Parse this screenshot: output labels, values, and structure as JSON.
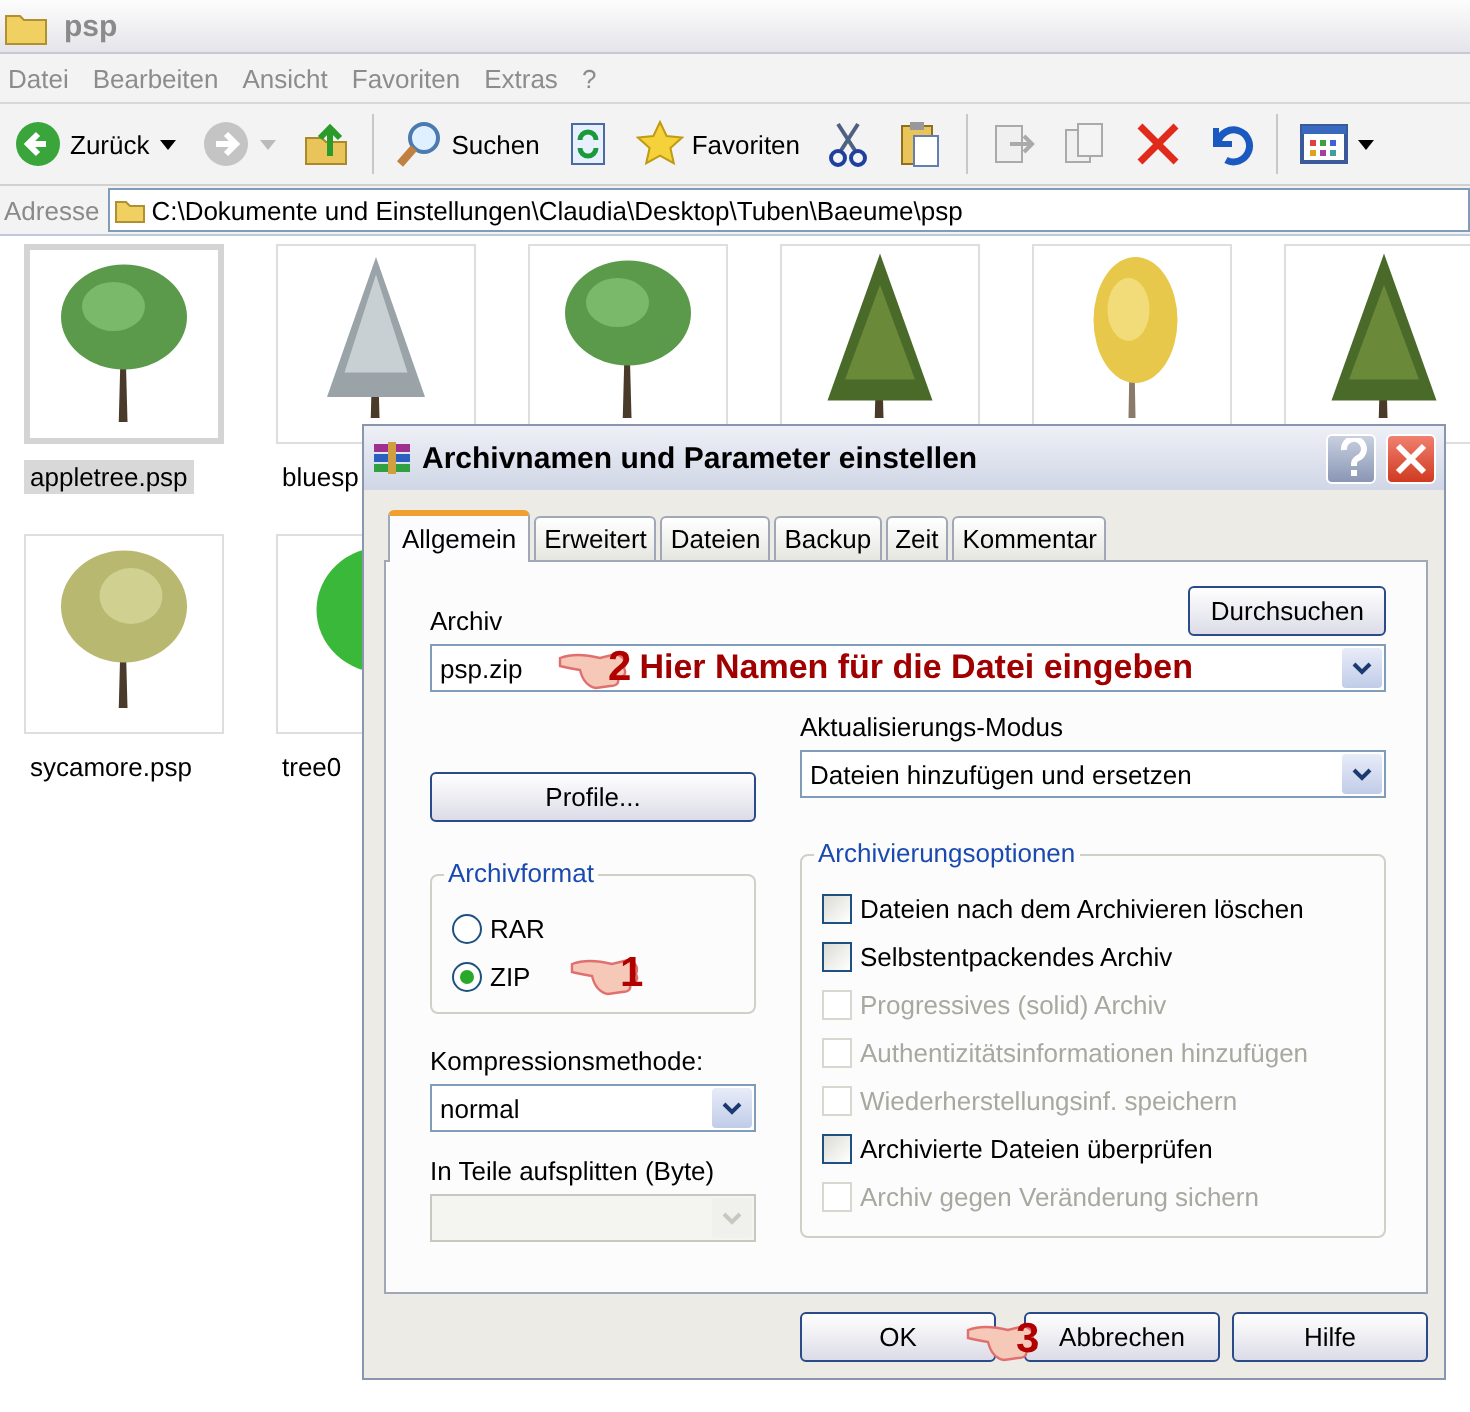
{
  "window": {
    "title": "psp"
  },
  "menu": [
    "Datei",
    "Bearbeiten",
    "Ansicht",
    "Favoriten",
    "Extras",
    "?"
  ],
  "toolbar": [
    {
      "kind": "back",
      "label": "Zurück"
    },
    {
      "kind": "forward"
    },
    {
      "kind": "up"
    },
    {
      "kind": "search",
      "label": "Suchen"
    },
    {
      "kind": "sync"
    },
    {
      "kind": "favorites",
      "label": "Favoriten"
    },
    {
      "kind": "cut"
    },
    {
      "kind": "paste"
    },
    {
      "kind": "moveto"
    },
    {
      "kind": "copyto"
    },
    {
      "kind": "delete"
    },
    {
      "kind": "undo"
    },
    {
      "kind": "views"
    }
  ],
  "address": {
    "label": "Adresse",
    "value": "C:\\Dokumente und Einstellungen\\Claudia\\Desktop\\Tuben\\Baeume\\psp"
  },
  "files": [
    {
      "kind": "round",
      "name": "appletree.psp",
      "selected": true
    },
    {
      "kind": "spruce",
      "name": "bluesp",
      "selected": false
    },
    {
      "kind": "round",
      "selected": false
    },
    {
      "kind": "conifer",
      "selected": false
    },
    {
      "kind": "birch",
      "selected": false
    },
    {
      "kind": "conifer",
      "selected": false
    },
    {
      "kind": "sycamore",
      "name": "sycamore.psp",
      "selected": false
    },
    {
      "kind": "bright",
      "name": "tree0",
      "selected": false
    }
  ],
  "dialog": {
    "title": "Archivnamen und Parameter einstellen",
    "tabs": [
      {
        "label": "Allgemein",
        "selected": true
      },
      {
        "label": "Erweitert",
        "selected": false
      },
      {
        "label": "Dateien",
        "selected": false
      },
      {
        "label": "Backup",
        "selected": false
      },
      {
        "label": "Zeit",
        "selected": false
      },
      {
        "label": "Kommentar",
        "selected": false
      }
    ],
    "archive": {
      "label": "Archiv",
      "value": "psp.zip",
      "browse": "Durchsuchen",
      "pointer": {
        "number": "2",
        "text": "Hier Namen für die Datei eingeben"
      }
    },
    "profiles_button": "Profile...",
    "update_mode": {
      "label": "Aktualisierungs-Modus",
      "value": "Dateien hinzufügen und ersetzen"
    },
    "format": {
      "title": "Archivformat",
      "options": [
        {
          "label": "RAR",
          "selected": false
        },
        {
          "label": "ZIP",
          "selected": true
        }
      ],
      "pointer": {
        "number": "1"
      }
    },
    "compression": {
      "label": "Kompressionsmethode:",
      "value": "normal"
    },
    "split": {
      "label": "In Teile aufsplitten (Byte)",
      "disabled": true
    },
    "options": {
      "title": "Archivierungsoptionen",
      "items": [
        {
          "label": "Dateien nach dem Archivieren löschen",
          "checked": false,
          "disabled": false
        },
        {
          "label": "Selbstentpackendes Archiv",
          "checked": false,
          "disabled": false
        },
        {
          "label": "Progressives (solid) Archiv",
          "checked": false,
          "disabled": true
        },
        {
          "label": "Authentizitätsinformationen hinzufügen",
          "checked": false,
          "disabled": true
        },
        {
          "label": "Wiederherstellungsinf. speichern",
          "checked": false,
          "disabled": true
        },
        {
          "label": "Archivierte Dateien überprüfen",
          "checked": false,
          "disabled": false
        },
        {
          "label": "Archiv gegen Veränderung sichern",
          "checked": false,
          "disabled": true
        }
      ]
    },
    "buttons": [
      "OK",
      "Abbrechen",
      "Hilfe"
    ],
    "buttons_pointer": {
      "number": "3"
    }
  }
}
